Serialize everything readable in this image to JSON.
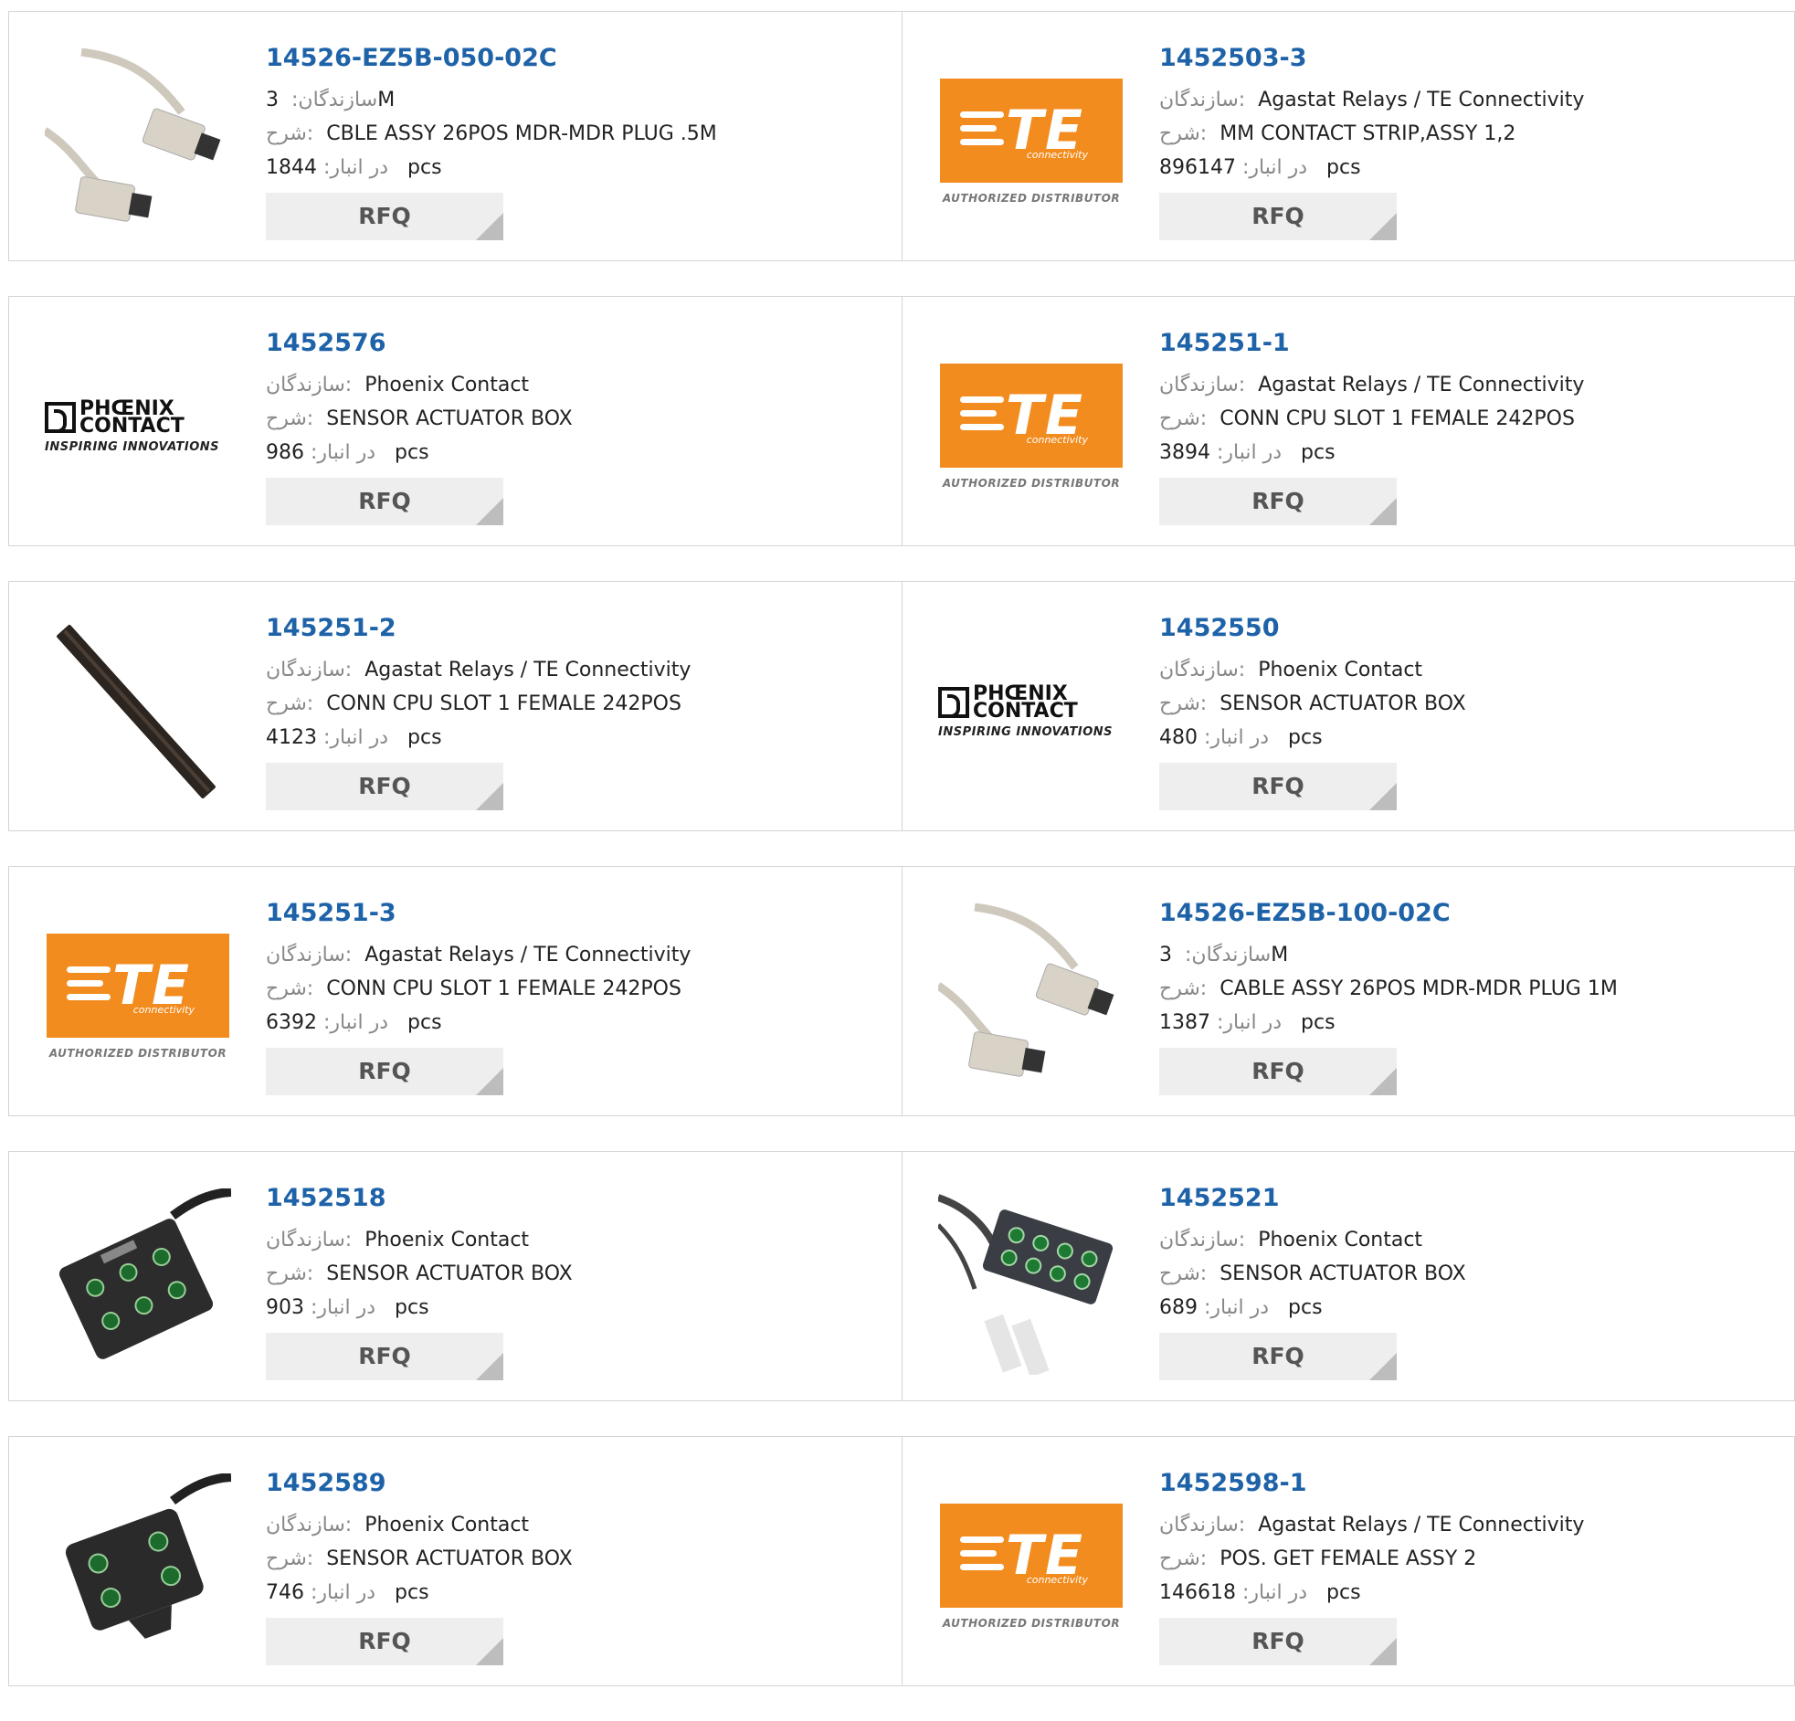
{
  "labels": {
    "manufacturer": "سازندگان",
    "description": "شرح",
    "stock": "در انبار",
    "unit": "pcs",
    "rfq": "RFQ"
  },
  "brand_logos": {
    "te": {
      "text": "TE",
      "sub": "connectivity",
      "tagline": "AUTHORIZED DISTRIBUTOR",
      "color": "#f28c1e"
    },
    "phoenix": {
      "name_line1": "PHŒNIX",
      "name_line2": "CONTACT",
      "tagline": "INSPIRING INNOVATIONS"
    }
  },
  "products": [
    {
      "part_number": "14526-EZ5B-050-02C",
      "manufacturer": "3M",
      "description": "CBLE ASSY 26POS MDR-MDR PLUG .5M",
      "stock": "1844",
      "image": "cable-connector-image"
    },
    {
      "part_number": "1452503-3",
      "manufacturer": "Agastat Relays / TE Connectivity",
      "description": "MM CONTACT STRIP,ASSY 1,2",
      "stock": "896147",
      "image": "te-logo"
    },
    {
      "part_number": "1452576",
      "manufacturer": "Phoenix Contact",
      "description": "SENSOR ACTUATOR BOX",
      "stock": "986",
      "image": "phoenix-logo"
    },
    {
      "part_number": "145251-1",
      "manufacturer": "Agastat Relays / TE Connectivity",
      "description": "CONN CPU SLOT 1 FEMALE 242POS",
      "stock": "3894",
      "image": "te-logo"
    },
    {
      "part_number": "145251-2",
      "manufacturer": "Agastat Relays / TE Connectivity",
      "description": "CONN CPU SLOT 1 FEMALE 242POS",
      "stock": "4123",
      "image": "cpu-slot-image"
    },
    {
      "part_number": "1452550",
      "manufacturer": "Phoenix Contact",
      "description": "SENSOR ACTUATOR BOX",
      "stock": "480",
      "image": "phoenix-logo"
    },
    {
      "part_number": "145251-3",
      "manufacturer": "Agastat Relays / TE Connectivity",
      "description": "CONN CPU SLOT 1 FEMALE 242POS",
      "stock": "6392",
      "image": "te-logo"
    },
    {
      "part_number": "14526-EZ5B-100-02C",
      "manufacturer": "3M",
      "description": "CABLE ASSY 26POS MDR-MDR PLUG 1M",
      "stock": "1387",
      "image": "cable-connector-image"
    },
    {
      "part_number": "1452518",
      "manufacturer": "Phoenix Contact",
      "description": "SENSOR ACTUATOR BOX",
      "stock": "903",
      "image": "sensor-box-image"
    },
    {
      "part_number": "1452521",
      "manufacturer": "Phoenix Contact",
      "description": "SENSOR ACTUATOR BOX",
      "stock": "689",
      "image": "sensor-box-cable-image"
    },
    {
      "part_number": "1452589",
      "manufacturer": "Phoenix Contact",
      "description": "SENSOR ACTUATOR BOX",
      "stock": "746",
      "image": "sensor-box-small-image"
    },
    {
      "part_number": "1452598-1",
      "manufacturer": "Agastat Relays / TE Connectivity",
      "description": "POS. GET FEMALE ASSY 2",
      "stock": "146618",
      "image": "te-logo"
    }
  ]
}
